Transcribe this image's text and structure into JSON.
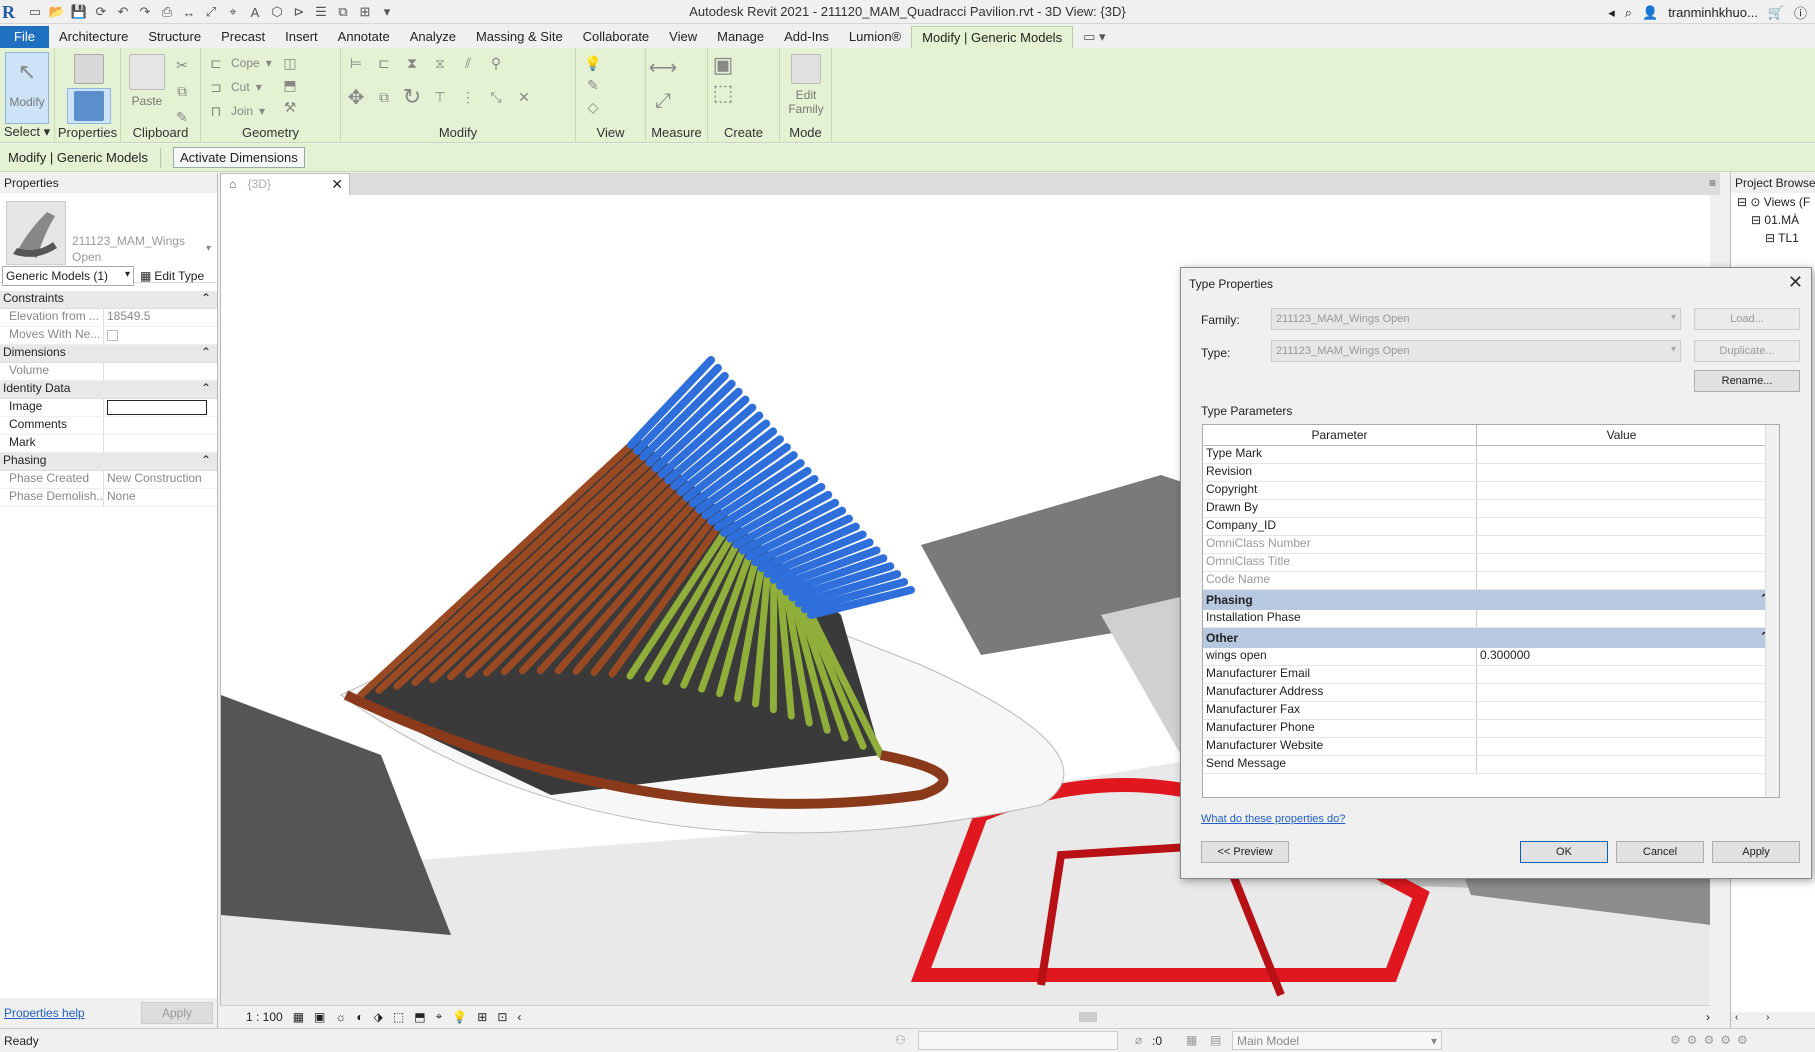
{
  "window": {
    "title": "Autodesk Revit 2021 - 211120_MAM_Quadracci Pavilion.rvt - 3D View: {3D}",
    "user": "tranminhkhuo...",
    "logo": "R"
  },
  "ribbon": {
    "tabs": [
      "File",
      "Architecture",
      "Structure",
      "Precast",
      "Insert",
      "Annotate",
      "Analyze",
      "Massing & Site",
      "Collaborate",
      "View",
      "Manage",
      "Add-Ins",
      "Lumion®",
      "Modify | Generic Models"
    ],
    "active_tab": "Modify | Generic Models",
    "panels": {
      "select": "Select",
      "properties": "Properties",
      "clipboard": "Clipboard",
      "geometry": "Geometry",
      "modify": "Modify",
      "view": "View",
      "measure": "Measure",
      "create": "Create",
      "mode": "Mode"
    },
    "buttons": {
      "modify": "Modify",
      "properties": "Properties",
      "paste": "Paste",
      "cope": "Cope",
      "cut": "Cut",
      "join": "Join",
      "edit_family_1": "Edit",
      "edit_family_2": "Family"
    }
  },
  "optionsbar": {
    "context": "Modify | Generic Models",
    "activate_dimensions": "Activate Dimensions"
  },
  "properties": {
    "header": "Properties",
    "type_name_1": "211123_MAM_Wings",
    "type_name_2": "Open",
    "filter": "Generic Models (1)",
    "edit_type": "Edit Type",
    "groups": {
      "constraints": "Constraints",
      "dimensions": "Dimensions",
      "identity": "Identity Data",
      "phasing": "Phasing"
    },
    "rows": {
      "elevation_label": "Elevation from ...",
      "elevation_value": "18549.5",
      "moves_label": "Moves With Ne...",
      "volume_label": "Volume",
      "image_label": "Image",
      "comments_label": "Comments",
      "mark_label": "Mark",
      "phase_created_label": "Phase Created",
      "phase_created_value": "New Construction",
      "phase_demolished_label": "Phase Demolish...",
      "phase_demolished_value": "None"
    },
    "help": "Properties help",
    "apply": "Apply"
  },
  "view": {
    "tab": "{3D}",
    "scale": "1 : 100"
  },
  "browser": {
    "header": "Project Browser",
    "node_views": "Views (F",
    "node_01": "01.MÀ",
    "node_tl": "TL1"
  },
  "status": {
    "text": "Ready",
    "worksets": ":0",
    "model": "Main Model"
  },
  "dialog": {
    "title": "Type Properties",
    "family_label": "Family:",
    "family_value": "211123_MAM_Wings Open",
    "type_label": "Type:",
    "type_value": "211123_MAM_Wings Open",
    "load": "Load...",
    "duplicate": "Duplicate...",
    "rename": "Rename...",
    "type_parameters": "Type Parameters",
    "col_parameter": "Parameter",
    "col_value": "Value",
    "rows_top": [
      {
        "p": "Type Mark",
        "v": ""
      },
      {
        "p": "Revision",
        "v": ""
      },
      {
        "p": "Copyright",
        "v": ""
      },
      {
        "p": "Drawn By",
        "v": ""
      },
      {
        "p": "Company_ID",
        "v": ""
      },
      {
        "p": "OmniClass Number",
        "v": ""
      },
      {
        "p": "OmniClass Title",
        "v": ""
      },
      {
        "p": "Code Name",
        "v": ""
      }
    ],
    "group_phasing": "Phasing",
    "installation_phase": "Installation Phase",
    "group_other": "Other",
    "wings_open_label": "wings open",
    "wings_open_value": "0.300000",
    "rows_other": [
      {
        "p": "Manufacturer Email",
        "v": ""
      },
      {
        "p": "Manufacturer Address",
        "v": ""
      },
      {
        "p": "Manufacturer Fax",
        "v": ""
      },
      {
        "p": "Manufacturer Phone",
        "v": ""
      },
      {
        "p": "Manufacturer Website",
        "v": ""
      },
      {
        "p": "Send Message",
        "v": ""
      }
    ],
    "help_link": "What do these properties do?",
    "preview": "<< Preview",
    "ok": "OK",
    "cancel": "Cancel",
    "apply": "Apply"
  },
  "colors": {
    "ribbon_bg": "#e4f1d2",
    "file_tab": "#1f70c1",
    "group_header": "#b6c9e0",
    "wing_blue": "#2f6fdc",
    "wing_green": "#8fae3a",
    "wing_brown": "#9a4a22",
    "frame_red": "#e0171e"
  }
}
